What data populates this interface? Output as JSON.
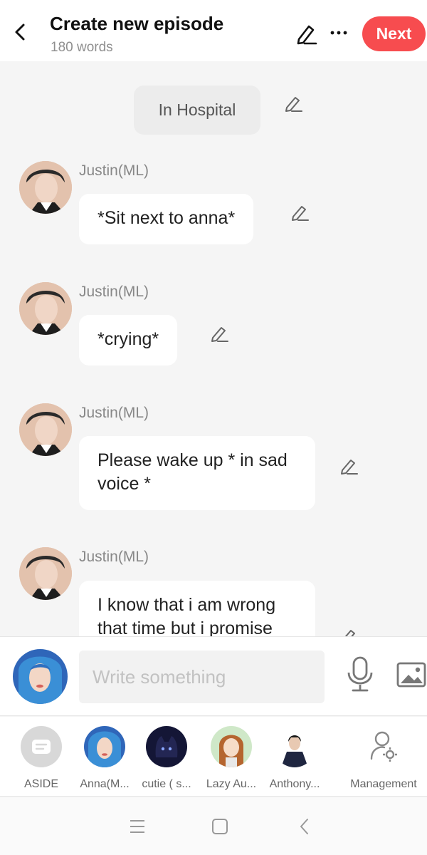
{
  "header": {
    "title": "Create new episode",
    "word_count": "180 words",
    "next_label": "Next",
    "accent_color": "#f74c4f"
  },
  "scene": {
    "label": "In Hospital"
  },
  "messages": [
    {
      "speaker": "Justin(ML)",
      "text": "*Sit next to anna*"
    },
    {
      "speaker": "Justin(ML)",
      "text": "*crying*"
    },
    {
      "speaker": "Justin(ML)",
      "text": "Please wake up * in sad voice *"
    },
    {
      "speaker": "Justin(ML)",
      "text": "I know that i am wrong that time but i promise"
    }
  ],
  "composer": {
    "placeholder": "Write something"
  },
  "characters": [
    {
      "label": "ASIDE",
      "icon": "aside-icon"
    },
    {
      "label": "Anna(M...",
      "icon": "anna-avatar"
    },
    {
      "label": "cutie ( s...",
      "icon": "cutie-avatar"
    },
    {
      "label": "Lazy Au...",
      "icon": "lazy-avatar"
    },
    {
      "label": "Anthony...",
      "icon": "anthony-avatar"
    },
    {
      "label": "Management",
      "icon": "management-icon"
    }
  ],
  "system_nav": [
    "menu-icon",
    "home-icon",
    "back-icon"
  ]
}
